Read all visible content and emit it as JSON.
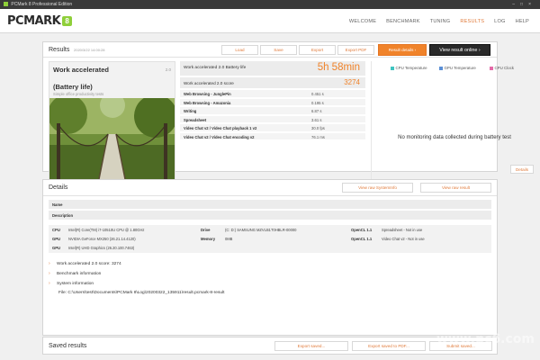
{
  "window": {
    "title": "PCMark 8 Professional Edition"
  },
  "brand": {
    "logo_text": "PCMARK",
    "logo_badge": "8",
    "accent": "#f0832a",
    "green": "#8fcf3a"
  },
  "nav": {
    "items": [
      "WELCOME",
      "BENCHMARK",
      "TUNING",
      "RESULTS",
      "LOG",
      "HELP"
    ],
    "active": "RESULTS"
  },
  "results": {
    "title": "Results",
    "timestamp": "2020/3/22 14:00:28",
    "buttons": {
      "load": "Load",
      "save": "Save",
      "export": "Export",
      "export_pdf": "Export PDF",
      "result_details": "Result details",
      "view_online": "View result online"
    },
    "test": {
      "name_line1": "Work accelerated",
      "name_line2": "(Battery life)",
      "subtitle": "Simple office productivity tests",
      "number": "2.0"
    },
    "battery_label": "Work accelerated 2.0 Battery life",
    "battery_value": "5h 58min",
    "score_label": "Work accelerated 2.0 score",
    "score_value": "3274",
    "subtests": [
      {
        "name": "Web Browsing - JunglePin",
        "value": "0.451 s"
      },
      {
        "name": "Web Browsing - Amazonia",
        "value": "0.195 s"
      },
      {
        "name": "Writing",
        "value": "6.87 s"
      },
      {
        "name": "Spreadsheet",
        "value": "3.61 s"
      },
      {
        "name": "Video Chat v2 / Video Chat playback 1 v2",
        "value": "30.0 fps"
      },
      {
        "name": "Video Chat v2 / Video Chat encoding v2",
        "value": "76.1 ms"
      }
    ],
    "monitor": {
      "legend": [
        {
          "name": "CPU Temperature",
          "color": "#3fc4c0"
        },
        {
          "name": "GPU Temperature",
          "color": "#5b8fd6"
        },
        {
          "name": "CPU Clock",
          "color": "#e46aa8"
        }
      ],
      "no_data": "No monitoring data collected during battery test",
      "details_button": "Details"
    }
  },
  "details": {
    "title": "Details",
    "buttons": {
      "systeminfo": "View raw SystemInfo",
      "result": "View raw result"
    },
    "name_label": "Name",
    "description_label": "Description",
    "hardware": {
      "cpu_label": "CPU",
      "cpu": "Intel(R) Core(TM) i7-10510U CPU @ 1.80GHz",
      "gpu_label": "GPU",
      "gpu1": "NVIDIA GeForce MX250 (26.21.14.4120)",
      "gpu2": "Intel(R) UHD Graphics (26.20.100.7463)",
      "drive_label": "Drive",
      "drive": "(C: D:) SAMSUNG MZVLB1T0HBLR-00000",
      "memory_label": "Memory",
      "memory": "0MB",
      "opencl_label": "OpenCL 1.1",
      "opencl1": "Spreadsheet - Not in use",
      "opencl2": "Video Chat v2 - Not in use"
    },
    "accordion": [
      "Work accelerated 2.0 score: 3274",
      "Benchmark information",
      "System information"
    ],
    "file": "File: C:\\Users\\test\\Documents\\PCMark 8\\Log\\20200322_135911\\result.pcmark-8-result"
  },
  "saved": {
    "title": "Saved results",
    "buttons": {
      "export_saved": "Export saved...",
      "export_pdf": "Export saved to PDF...",
      "submit": "Submit saved..."
    }
  },
  "watermark": "www.pc6.com"
}
